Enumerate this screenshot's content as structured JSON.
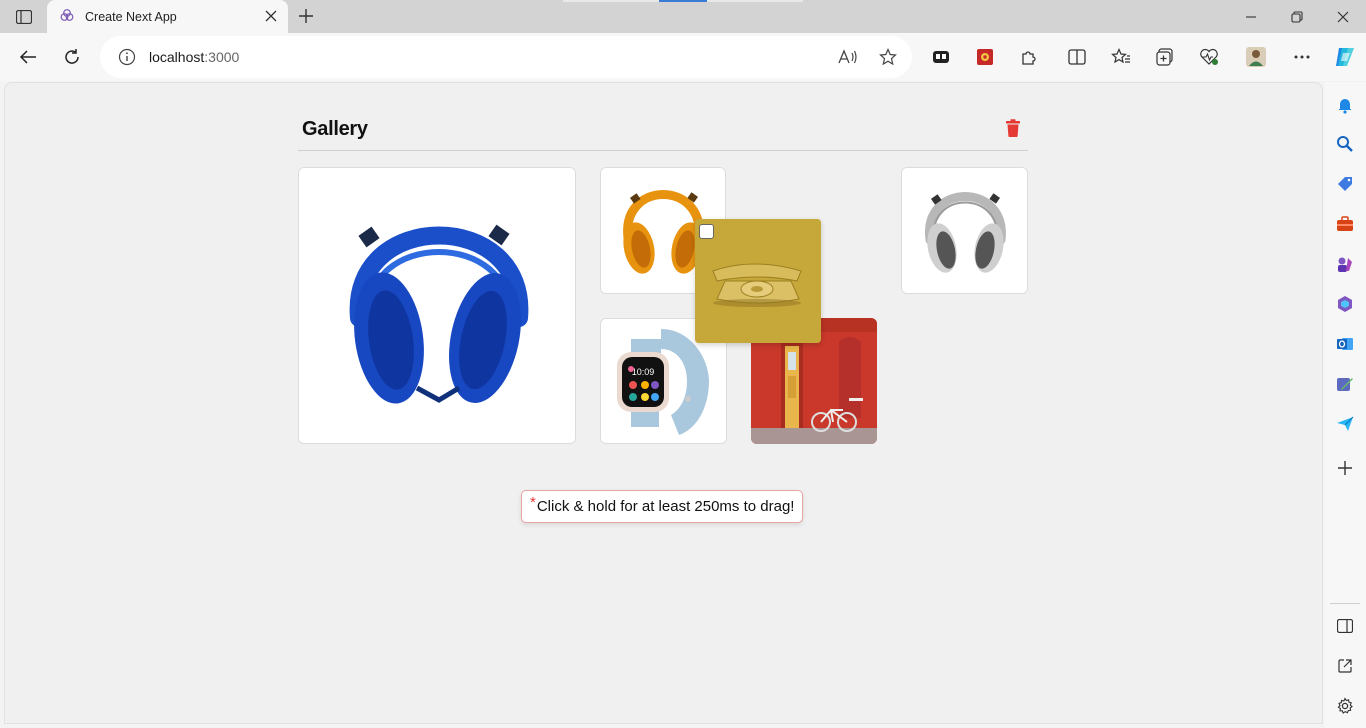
{
  "browser": {
    "tab_title": "Create Next App",
    "url_host": "localhost",
    "url_port": ":3000"
  },
  "gallery": {
    "title": "Gallery",
    "images": [
      {
        "name": "blue-headphones",
        "state": "featured"
      },
      {
        "name": "orange-headphones",
        "state": "normal"
      },
      {
        "name": "silver-headphones",
        "state": "normal"
      },
      {
        "name": "smartwatch",
        "state": "normal"
      },
      {
        "name": "red-wall-door-bicycle",
        "state": "normal"
      },
      {
        "name": "yellow-rotary-phone",
        "state": "dragging"
      }
    ],
    "hint_marker": "*",
    "hint_text": "Click & hold for at least 250ms to drag!"
  },
  "colors": {
    "delete": "#e53935",
    "drag_card_bg": "#c6a73a",
    "hint_border": "#e8a3a3"
  },
  "icons": {
    "tab_actions": "tab-actions-icon",
    "favicon": "nextjs-favicon-icon",
    "back": "back-arrow-icon",
    "refresh": "refresh-icon",
    "info": "site-info-icon",
    "read_aloud": "read-aloud-icon",
    "favorite": "star-icon",
    "delete": "trash-icon"
  }
}
